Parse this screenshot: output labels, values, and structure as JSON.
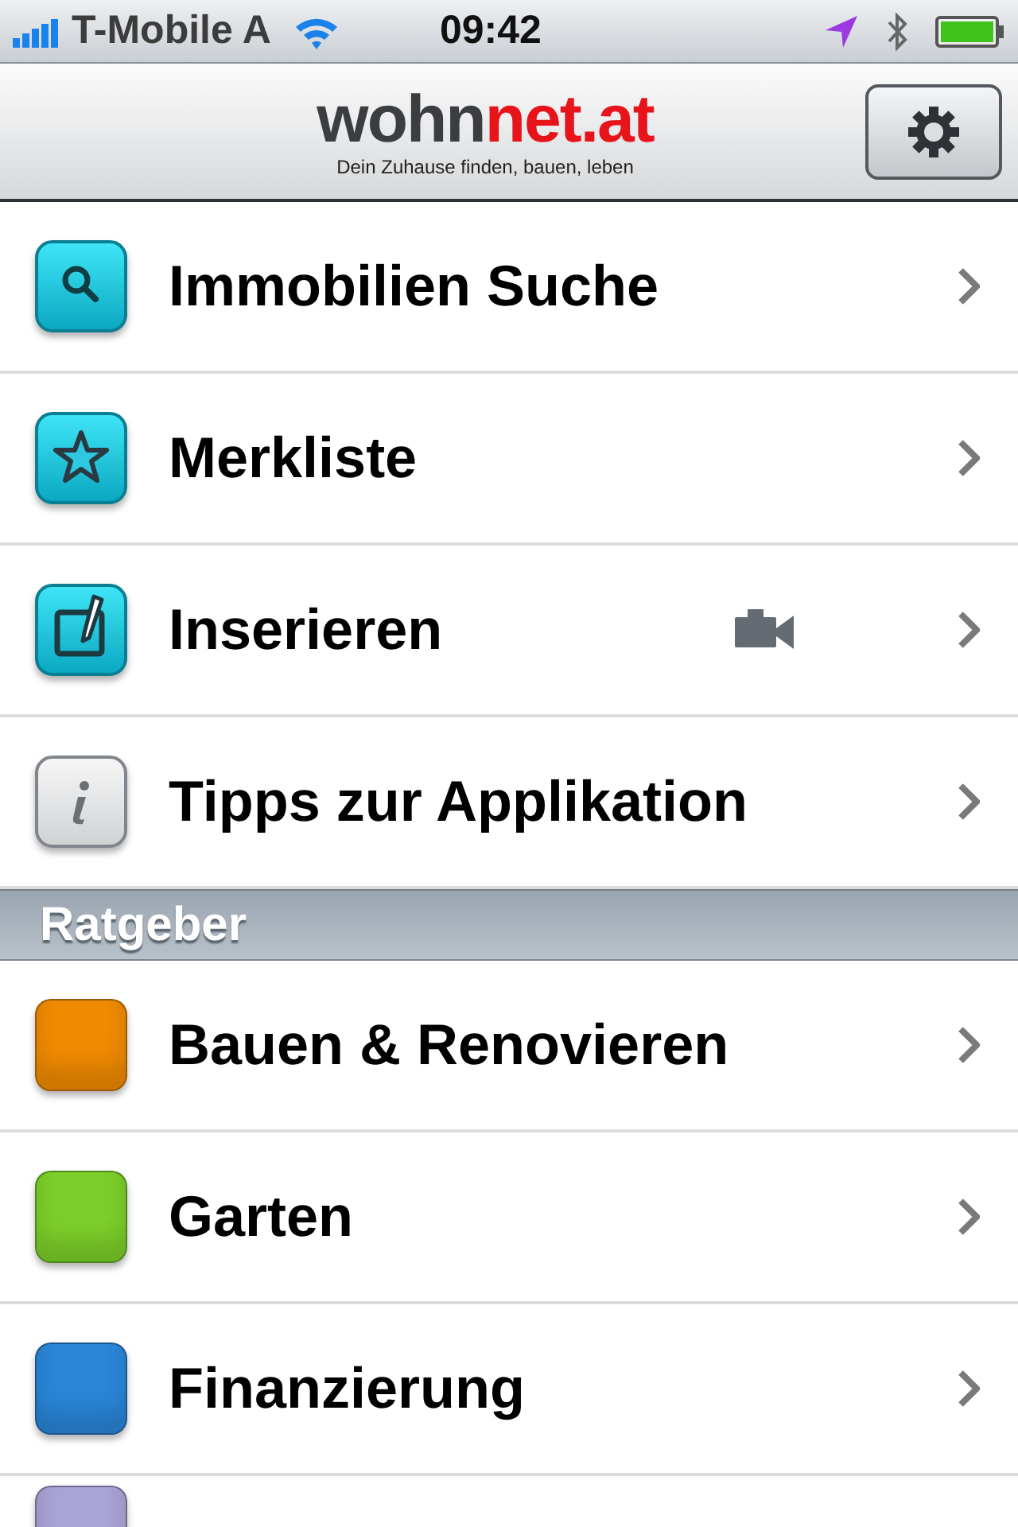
{
  "status_bar": {
    "carrier": "T-Mobile A",
    "time": "09:42"
  },
  "nav_bar": {
    "logo_main": "wohn",
    "logo_accent": "net.at",
    "tagline": "Dein Zuhause finden, bauen, leben"
  },
  "menu": [
    {
      "label": "Immobilien Suche",
      "kind": "search"
    },
    {
      "label": "Merkliste",
      "kind": "star"
    },
    {
      "label": "Inserieren",
      "kind": "edit",
      "video": true
    },
    {
      "label": "Tipps zur Applikation",
      "kind": "info"
    }
  ],
  "section": {
    "title": "Ratgeber",
    "items": [
      {
        "label": "Bauen & Renovieren",
        "kind": "tile",
        "color": "#f08a00"
      },
      {
        "label": "Garten",
        "kind": "tile",
        "color": "#7ccf2a"
      },
      {
        "label": "Finanzierung",
        "kind": "tile",
        "color": "#2a86d8"
      },
      {
        "kind": "tile",
        "color": "#a9a3d6"
      }
    ]
  }
}
